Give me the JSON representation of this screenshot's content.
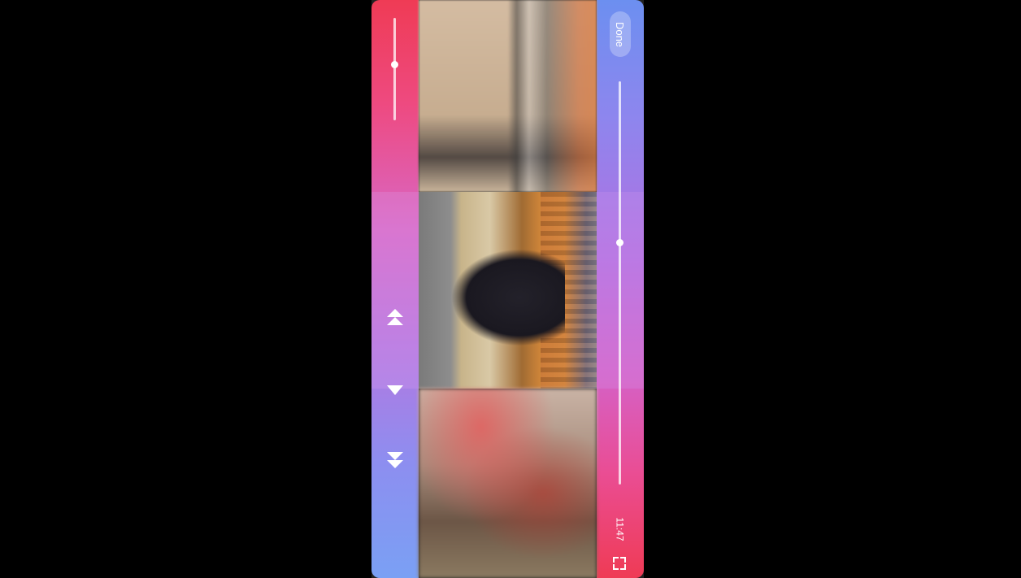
{
  "player": {
    "done_label": "Done",
    "time": "11:47"
  },
  "controls": {
    "top_slider_level": 0.45,
    "timeline_level": 0.4,
    "icons": [
      "skip-up-icon",
      "play-icon",
      "skip-down-icon",
      "fullscreen-icon"
    ]
  },
  "colors": {
    "bar_red": "#ef3b55",
    "bar_pink": "#ea4d93",
    "bar_purple": "#b36fe0",
    "bar_blue": "#6c8ff0"
  }
}
